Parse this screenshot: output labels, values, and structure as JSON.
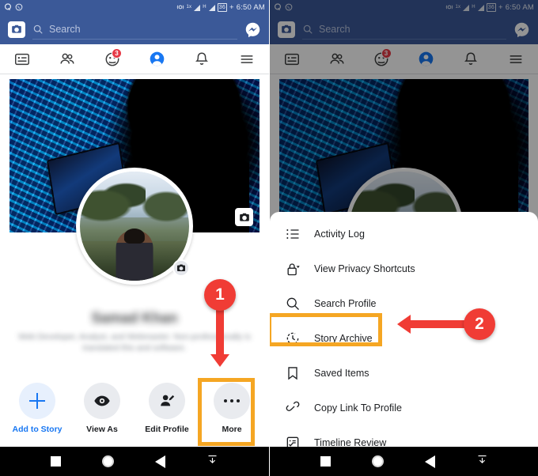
{
  "status_bar": {
    "left_icons": [
      "quora-icon",
      "whatsapp-icon"
    ],
    "network_label": "1x",
    "network_label2": "H",
    "battery": "36",
    "time": "6:50 AM"
  },
  "header": {
    "camera_icon": "camera-icon",
    "search_icon": "search-icon",
    "search_placeholder": "Search",
    "search_value": "",
    "messenger_icon": "messenger-icon"
  },
  "tabs": [
    {
      "name": "news-feed",
      "icon": "news-feed-icon",
      "active": false,
      "badge": ""
    },
    {
      "name": "friends",
      "icon": "friends-icon",
      "active": false,
      "badge": ""
    },
    {
      "name": "groups",
      "icon": "groups-icon",
      "active": false,
      "badge": "3"
    },
    {
      "name": "profile",
      "icon": "profile-icon",
      "active": true,
      "badge": ""
    },
    {
      "name": "notifications",
      "icon": "bell-icon",
      "active": false,
      "badge": ""
    },
    {
      "name": "menu",
      "icon": "hamburger-menu-icon",
      "active": false,
      "badge": ""
    }
  ],
  "profile": {
    "cover_photo_alt": "blue LED wall with hooded figure",
    "cover_camera_icon": "camera-icon",
    "profile_camera_icon": "camera-icon",
    "name": "Samad Khan",
    "bio": "Web Developer, Analyst, and Webmaster. Non-professionally is translated this and software.",
    "actions": [
      {
        "name": "add-to-story",
        "label": "Add to Story",
        "icon": "plus-icon"
      },
      {
        "name": "view-as",
        "label": "View As",
        "icon": "eye-icon"
      },
      {
        "name": "edit-profile",
        "label": "Edit Profile",
        "icon": "edit-profile-icon"
      },
      {
        "name": "more",
        "label": "More",
        "icon": "ellipsis-icon",
        "highlighted": true
      }
    ]
  },
  "menu_sheet": {
    "items": [
      {
        "name": "activity-log",
        "label": "Activity Log",
        "icon": "list-icon",
        "highlighted": false
      },
      {
        "name": "view-privacy-shortcuts",
        "label": "View Privacy Shortcuts",
        "icon": "lock-icon",
        "highlighted": false
      },
      {
        "name": "search-profile",
        "label": "Search Profile",
        "icon": "search-icon",
        "highlighted": false
      },
      {
        "name": "story-archive",
        "label": "Story Archive",
        "icon": "clock-archive-icon",
        "highlighted": true
      },
      {
        "name": "saved-items",
        "label": "Saved Items",
        "icon": "bookmark-icon",
        "highlighted": false
      },
      {
        "name": "copy-link-to-profile",
        "label": "Copy Link To Profile",
        "icon": "link-icon",
        "highlighted": false
      },
      {
        "name": "timeline-review",
        "label": "Timeline Review",
        "icon": "timeline-review-icon",
        "highlighted": false
      }
    ]
  },
  "annotations": [
    {
      "name": "step-1",
      "number": "1",
      "direction": "down",
      "target": "more-button"
    },
    {
      "name": "step-2",
      "number": "2",
      "direction": "left",
      "target": "story-archive-item"
    }
  ],
  "nav_bar": {
    "recents_icon": "square-recents-icon",
    "home_icon": "circle-home-icon",
    "back_icon": "triangle-back-icon",
    "hide_icon": "hide-keyboard-icon"
  },
  "colors": {
    "fb_blue": "#3b5998",
    "accent_blue": "#1877f2",
    "highlight_orange": "#f5a623",
    "annotation_red": "#f03c35",
    "badge_red": "#e63946"
  }
}
